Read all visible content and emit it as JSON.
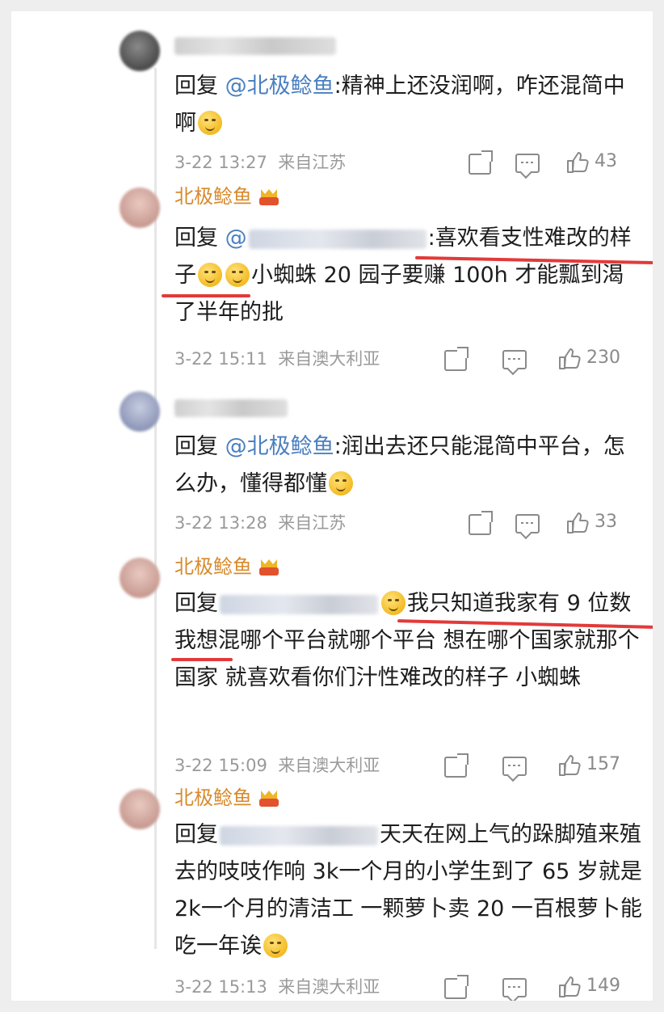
{
  "comments": [
    {
      "author": "",
      "reply_word": "回复",
      "mention": "@北极鲶鱼",
      "body": ":精神上还没润啊，咋还混简中啊",
      "emoji": "rofl-emoji",
      "time": "3-22 13:27",
      "location": "来自江苏",
      "likes": "43"
    },
    {
      "author": "北极鲶鱼",
      "reply_word": "回复",
      "mention_prefix": "@",
      "body_a": ":喜欢看支性难改的样子",
      "body_b": "小蜘蛛 20 园子要赚 100h 才能瓢到渴了半年的批",
      "time": "3-22 15:11",
      "location": "来自澳大利亚",
      "likes": "230"
    },
    {
      "author": "",
      "reply_word": "回复",
      "mention": "@北极鲶鱼",
      "body": ":润出去还只能混简中平台，怎么办，懂得都懂",
      "time": "3-22 13:28",
      "location": "来自江苏",
      "likes": "33"
    },
    {
      "author": "北极鲶鱼",
      "reply_word": "回复",
      "body": "我只知道我家有 9 位数 我想混哪个平台就哪个平台 想在哪个国家就那个国家 就喜欢看你们汁性难改的样子 小蜘蛛",
      "time": "3-22 15:09",
      "location": "来自澳大利亚",
      "likes": "157"
    },
    {
      "author": "北极鲶鱼",
      "reply_word": "回复",
      "body": "天天在网上气的跺脚殖来殖去的吱吱作响 3k一个月的小学生到了 65 岁就是 2k一个月的清洁工 一颗萝卜卖 20 一百根萝卜能吃一年诶",
      "time": "3-22 15:13",
      "location": "来自澳大利亚",
      "likes": "149"
    }
  ],
  "colors": {
    "author": "#d88a2c",
    "mention": "#4a7fc0",
    "meta": "#9a9a9a",
    "highlight_line": "#e23a3a"
  }
}
